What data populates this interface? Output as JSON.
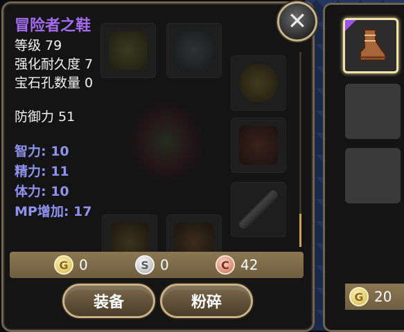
{
  "item": {
    "name": "冒险者之鞋",
    "name_color": "#a36cf0",
    "level_line": "等级 79",
    "durability_line": "强化耐久度 7",
    "gem_slots_line": "宝石孔数量 0",
    "defense_line": "防御力 51",
    "bonus_color": "#8f93ef",
    "bonus_stats": [
      "智力: 10",
      "精力: 11",
      "体力: 10",
      "MP增加: 17"
    ]
  },
  "close_button": {
    "label": "✕"
  },
  "currency": {
    "gold_symbol": "G",
    "gold_value": "0",
    "silver_symbol": "S",
    "silver_value": "0",
    "copper_symbol": "C",
    "copper_value": "42"
  },
  "actions": {
    "equip_label": "装备",
    "smash_label": "粉碎"
  },
  "inventory": {
    "slots": [
      {
        "item": "boots-icon",
        "selected": true,
        "rarity_color": "#9a53e6"
      },
      {
        "item": null,
        "selected": false
      },
      {
        "item": null,
        "selected": false
      }
    ],
    "gold_symbol": "G",
    "gold_value": "20"
  },
  "background_equipment_icons": [
    "helmet-icon",
    "necklace-icon",
    "ring-icon",
    "armor-icon",
    "weapon-icon",
    "gloves-icon",
    "boots-icon",
    "character-portrait"
  ]
}
